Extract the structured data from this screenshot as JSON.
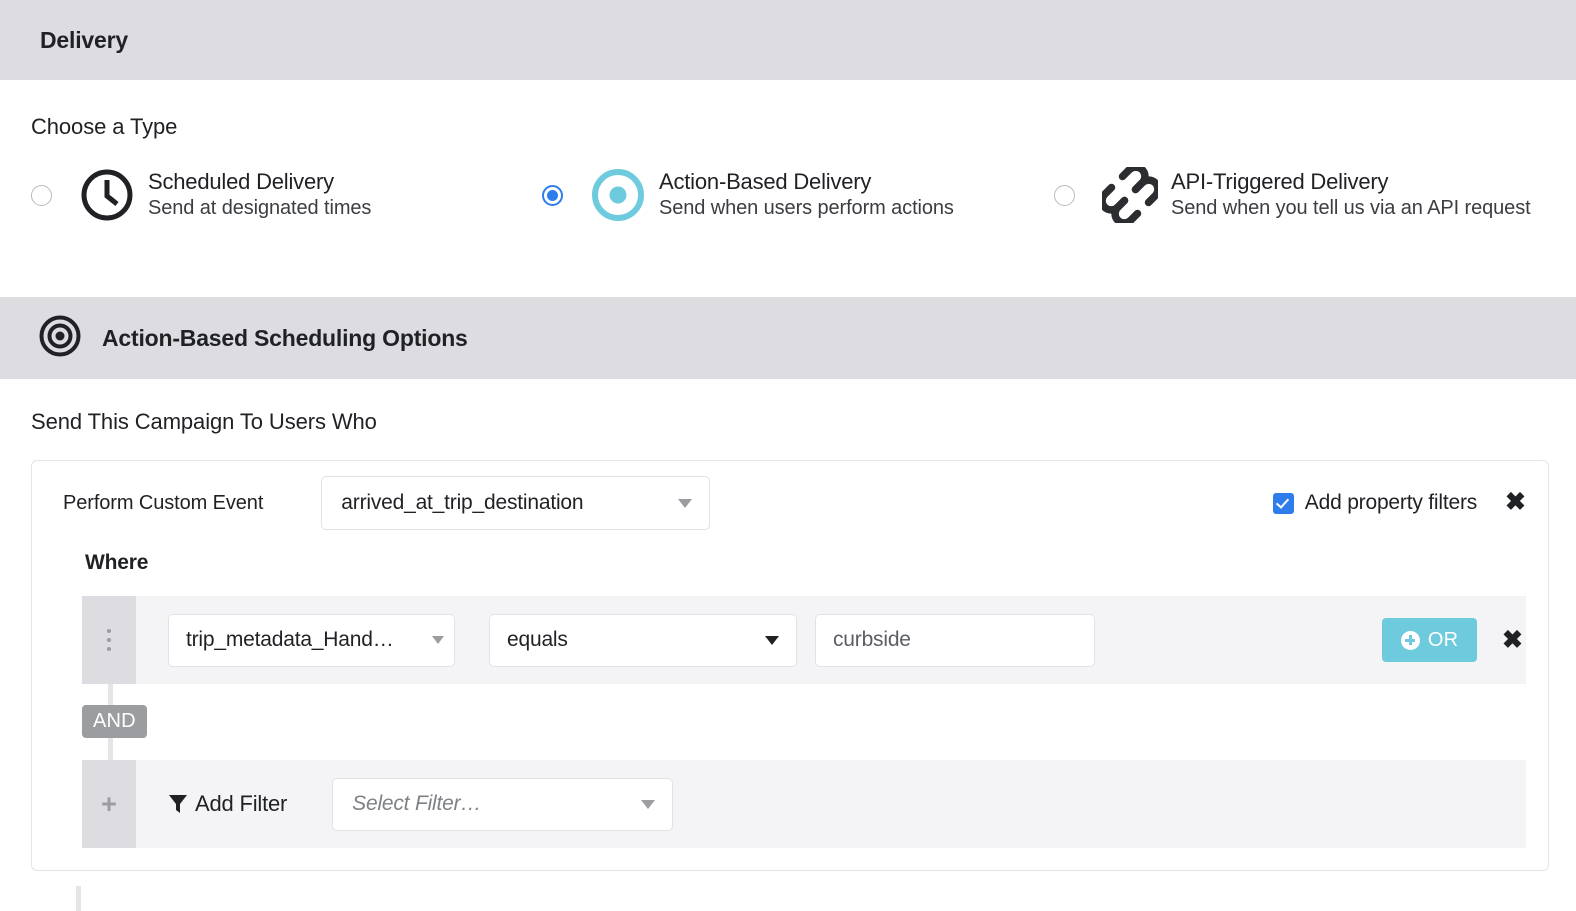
{
  "delivery_header": {
    "title": "Delivery"
  },
  "choose_type": {
    "label": "Choose a Type",
    "options": [
      {
        "title": "Scheduled Delivery",
        "subtitle": "Send at designated times",
        "icon": "clock-icon",
        "selected": false
      },
      {
        "title": "Action-Based Delivery",
        "subtitle": "Send when users perform actions",
        "icon": "target-icon",
        "selected": true
      },
      {
        "title": "API-Triggered Delivery",
        "subtitle": "Send when you tell us via an API request",
        "icon": "link-icon",
        "selected": false
      }
    ]
  },
  "scheduling_header": {
    "title": "Action-Based Scheduling Options",
    "icon": "target-icon"
  },
  "scheduling": {
    "send_label": "Send This Campaign To Users Who",
    "trigger": {
      "event_label": "Perform Custom Event",
      "event_value": "arrived_at_trip_destination",
      "property_filters_label": "Add property filters",
      "property_filters_checked": true,
      "close_label": "✖",
      "where_label": "Where"
    },
    "filters": [
      {
        "property": "trip_metadata_Hand…",
        "operator": "equals",
        "value": "curbside",
        "or_button_label": "OR",
        "remove_label": "✖"
      }
    ],
    "conjunction": "AND",
    "add_filter": {
      "label": "Add Filter",
      "select_placeholder": "Select Filter…"
    }
  },
  "colors": {
    "section_bar": "#dddde1",
    "radio_selected": "#2f7ded",
    "checkbox": "#2f7ded",
    "accent_teal": "#6ecbdd",
    "row_bg": "#f4f4f6",
    "handle_bg": "#dddde1",
    "and_badge": "#9b9da1"
  }
}
